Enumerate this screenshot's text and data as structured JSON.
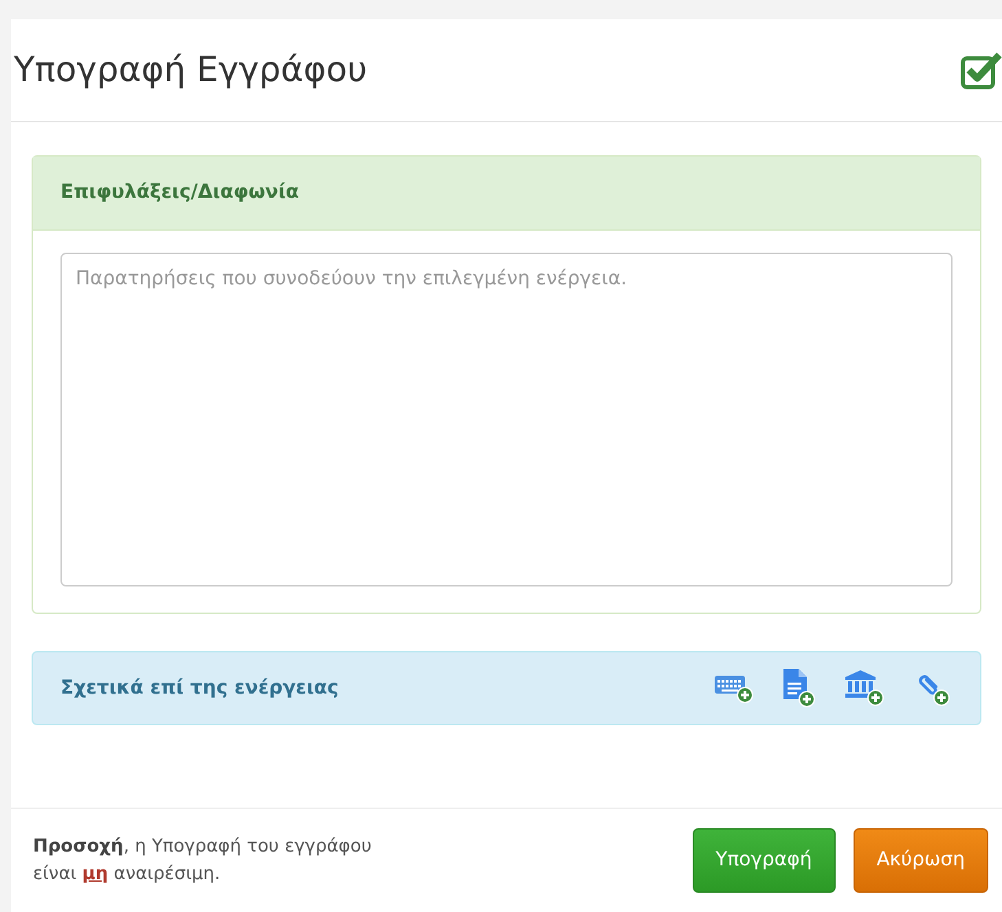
{
  "dialog": {
    "title": "Υπογραφή Εγγράφου"
  },
  "reservations": {
    "heading": "Επιφυλάξεις/Διαφωνία",
    "placeholder": "Παρατηρήσεις που συνοδεύουν την επιλεγμένη ενέργεια."
  },
  "related": {
    "heading": "Σχετικά επί της ενέργειας",
    "actions": [
      {
        "kind": "keyboard"
      },
      {
        "kind": "document"
      },
      {
        "kind": "institution"
      },
      {
        "kind": "attachment"
      }
    ]
  },
  "footer": {
    "warning": "**Προσοχή**, η Υπογραφή του εγγράφου είναι **μη** αναιρέσιμη.",
    "buttons": [
      {
        "label": "Υπογραφή",
        "kind": "confirm"
      },
      {
        "label": "Ακύρωση",
        "kind": "cancel"
      }
    ]
  }
}
